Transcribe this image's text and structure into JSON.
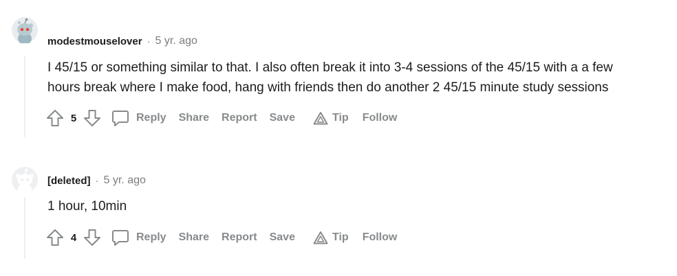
{
  "comments": [
    {
      "author": "modestmouselover",
      "separator": "·",
      "time": "5 yr. ago",
      "body_lines": [
        "I 45/15 or something similar to that. I also often break it into 3-4 sessions of the 45/15 with a a few",
        "hours break where I make food, hang with friends then do another 2 45/15 minute study sessions"
      ],
      "score": "5",
      "actions": {
        "reply": "Reply",
        "share": "Share",
        "report": "Report",
        "save": "Save",
        "tip": "Tip",
        "follow": "Follow"
      },
      "avatar": "snoo-avatar-icon"
    },
    {
      "author": "[deleted]",
      "separator": "·",
      "time": "5 yr. ago",
      "body_lines": [
        "1 hour, 10min"
      ],
      "score": "4",
      "actions": {
        "reply": "Reply",
        "share": "Share",
        "report": "Report",
        "save": "Save",
        "tip": "Tip",
        "follow": "Follow"
      },
      "avatar": "default-avatar-icon"
    }
  ],
  "colors": {
    "text": "#1c1c1c",
    "muted": "#7c7c7c",
    "action": "#878a8c",
    "thread_line": "#edeff1"
  }
}
